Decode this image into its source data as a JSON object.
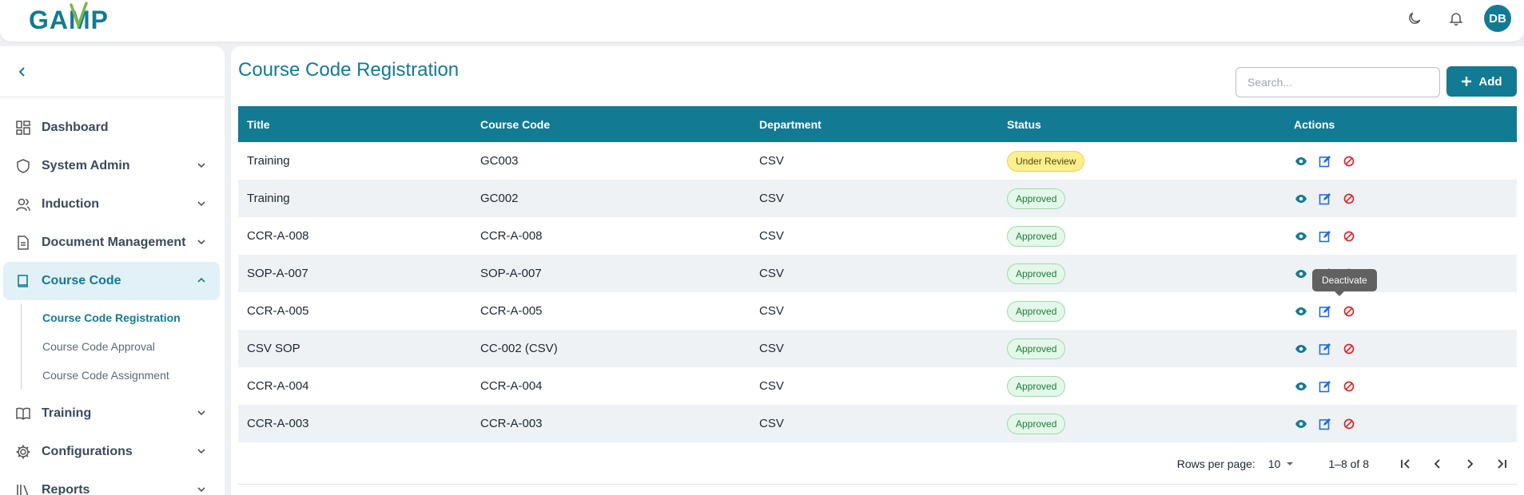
{
  "app": {
    "logo_text": "GAMP",
    "user_initials": "DB"
  },
  "sidebar": {
    "items": [
      {
        "label": "Dashboard",
        "icon": "dashboard-icon",
        "expandable": false
      },
      {
        "label": "System Admin",
        "icon": "shield-icon",
        "expandable": true
      },
      {
        "label": "Induction",
        "icon": "users-icon",
        "expandable": true
      },
      {
        "label": "Document Management",
        "icon": "document-icon",
        "expandable": true
      },
      {
        "label": "Course Code",
        "icon": "book-icon",
        "expandable": true,
        "expanded": true,
        "active": true
      },
      {
        "label": "Training",
        "icon": "open-book-icon",
        "expandable": true
      },
      {
        "label": "Configurations",
        "icon": "gear-icon",
        "expandable": true
      },
      {
        "label": "Reports",
        "icon": "library-icon",
        "expandable": true
      }
    ],
    "course_code_sub": [
      {
        "label": "Course Code Registration",
        "active": true
      },
      {
        "label": "Course Code Approval"
      },
      {
        "label": "Course Code Assignment"
      }
    ]
  },
  "main": {
    "title": "Course Code Registration",
    "search_placeholder": "Search...",
    "add_label": "Add",
    "columns": [
      "Title",
      "Course Code",
      "Department",
      "Status",
      "Actions"
    ],
    "rows": [
      {
        "title": "Training",
        "code": "GC003",
        "dept": "CSV",
        "status": "Under Review"
      },
      {
        "title": "Training",
        "code": "GC002",
        "dept": "CSV",
        "status": "Approved"
      },
      {
        "title": "CCR-A-008",
        "code": "CCR-A-008",
        "dept": "CSV",
        "status": "Approved"
      },
      {
        "title": "SOP-A-007",
        "code": "SOP-A-007",
        "dept": "CSV",
        "status": "Approved"
      },
      {
        "title": "CCR-A-005",
        "code": "CCR-A-005",
        "dept": "CSV",
        "status": "Approved"
      },
      {
        "title": "CSV SOP",
        "code": "CC-002 (CSV)",
        "dept": "CSV",
        "status": "Approved"
      },
      {
        "title": "CCR-A-004",
        "code": "CCR-A-004",
        "dept": "CSV",
        "status": "Approved"
      },
      {
        "title": "CCR-A-003",
        "code": "CCR-A-003",
        "dept": "CSV",
        "status": "Approved"
      }
    ],
    "tooltip": "Deactivate",
    "pagination": {
      "rows_per_page_label": "Rows per page:",
      "rows_per_page": "10",
      "range": "1–8 of 8"
    }
  },
  "colors": {
    "primary": "#137a94",
    "view": "#137a94",
    "edit": "#1e6fd9",
    "deactivate": "#d9262c"
  }
}
